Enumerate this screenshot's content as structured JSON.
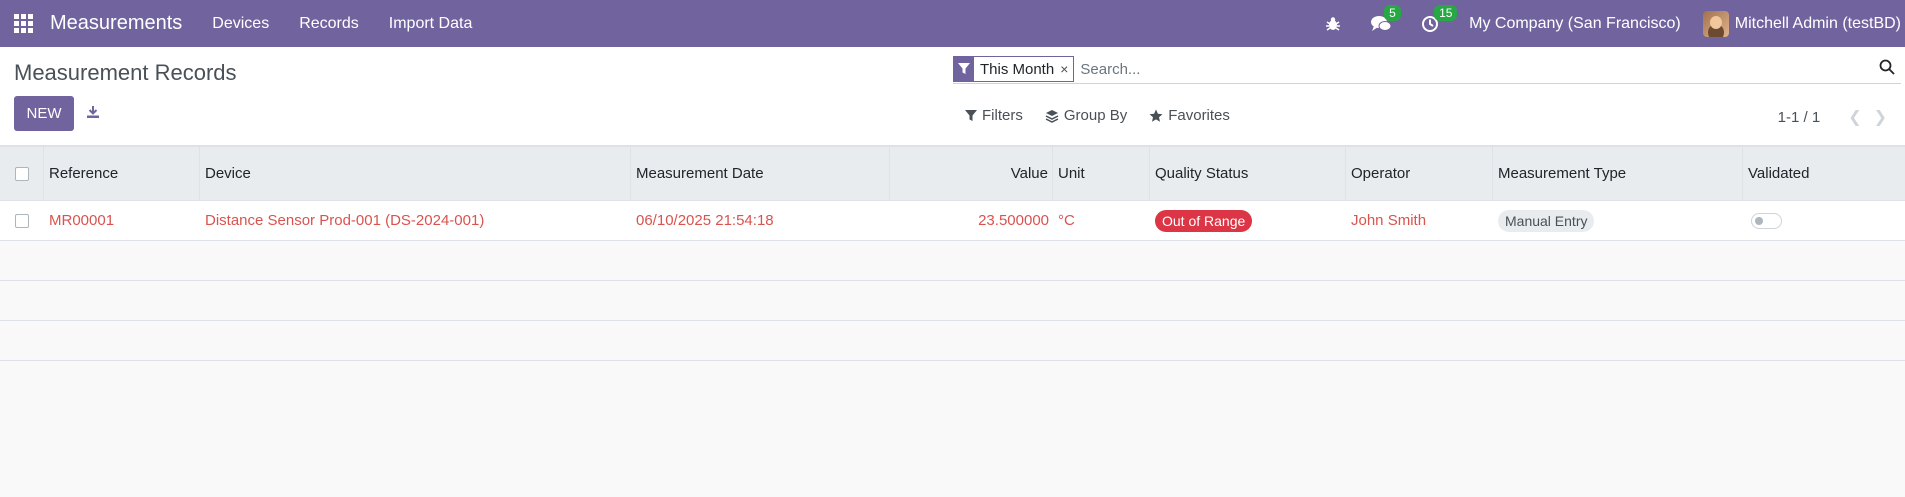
{
  "navbar": {
    "app_name": "Measurements",
    "menu": [
      "Devices",
      "Records",
      "Import Data"
    ],
    "messages_count": "5",
    "activities_count": "15",
    "company": "My Company (San Francisco)",
    "user": "Mitchell Admin (testBD)",
    "bg_color": "#71639e"
  },
  "control": {
    "title": "Measurement Records",
    "new_label": "NEW",
    "search": {
      "facet_label": "This Month",
      "facet_remove": "×",
      "placeholder": "Search..."
    },
    "filters_label": "Filters",
    "group_by_label": "Group By",
    "favorites_label": "Favorites",
    "pager_value": "1-1 / 1"
  },
  "table": {
    "columns": [
      "Reference",
      "Device",
      "Measurement Date",
      "Value",
      "Unit",
      "Quality Status",
      "Operator",
      "Measurement Type",
      "Validated"
    ],
    "rows": [
      {
        "reference": "MR00001",
        "device": "Distance Sensor Prod-001 (DS-2024-001)",
        "date": "06/10/2025 21:54:18",
        "value": "23.500000",
        "unit": "°C",
        "quality_status": "Out of Range",
        "operator": "John Smith",
        "measurement_type": "Manual Entry",
        "validated": false
      }
    ]
  }
}
